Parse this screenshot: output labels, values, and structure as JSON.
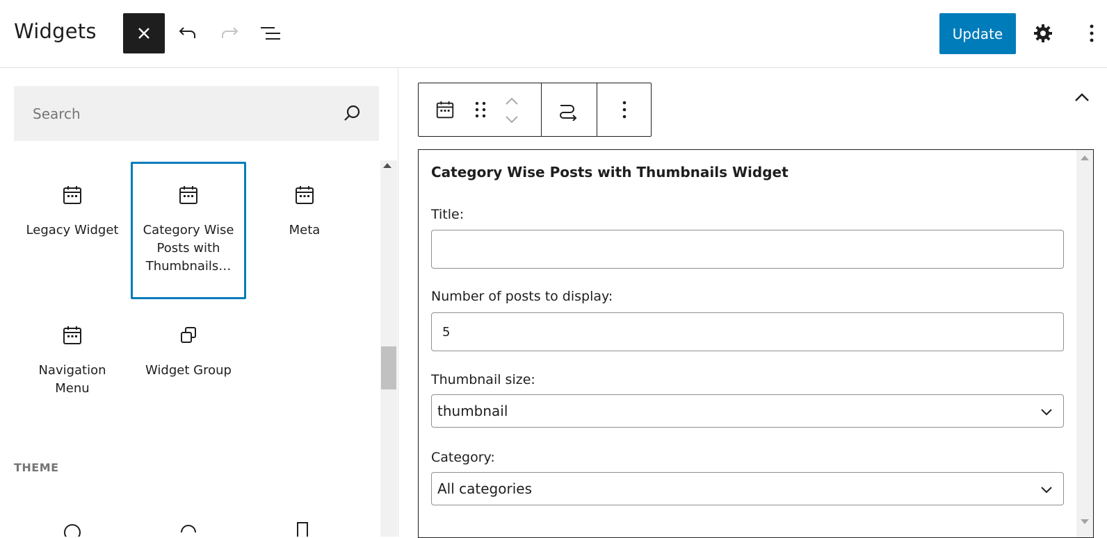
{
  "header": {
    "title": "Widgets",
    "update_label": "Update",
    "icons": [
      "close-icon",
      "undo-icon",
      "redo-icon",
      "list-view-icon",
      "gear-icon",
      "more-vertical-icon"
    ]
  },
  "inserter": {
    "search_placeholder": "Search",
    "blocks": [
      {
        "label": "Legacy Widget",
        "icon": "calendar-icon",
        "selected": false
      },
      {
        "label": "Category Wise Posts with Thumbnails…",
        "icon": "calendar-icon",
        "selected": true
      },
      {
        "label": "Meta",
        "icon": "calendar-icon",
        "selected": false
      },
      {
        "label": "Navigation Menu",
        "icon": "calendar-icon",
        "selected": false
      },
      {
        "label": "Widget Group",
        "icon": "group-icon",
        "selected": false
      }
    ],
    "theme_heading": "THEME"
  },
  "block_toolbar": {
    "icons": [
      "calendar-icon",
      "drag-handle-icon",
      "move-up-icon",
      "move-down-icon",
      "transform-icon",
      "more-vertical-icon"
    ]
  },
  "widget": {
    "heading": "Category Wise Posts with Thumbnails Widget",
    "title_label": "Title:",
    "title_value": "",
    "num_posts_label": "Number of posts to display:",
    "num_posts_value": "5",
    "thumb_size_label": "Thumbnail size:",
    "thumb_size_value": "thumbnail",
    "category_label": "Category:",
    "category_value": "All categories"
  },
  "colors": {
    "accent": "#007cba",
    "dark": "#1e1e1e",
    "panel_bg": "#f0f0f0"
  }
}
